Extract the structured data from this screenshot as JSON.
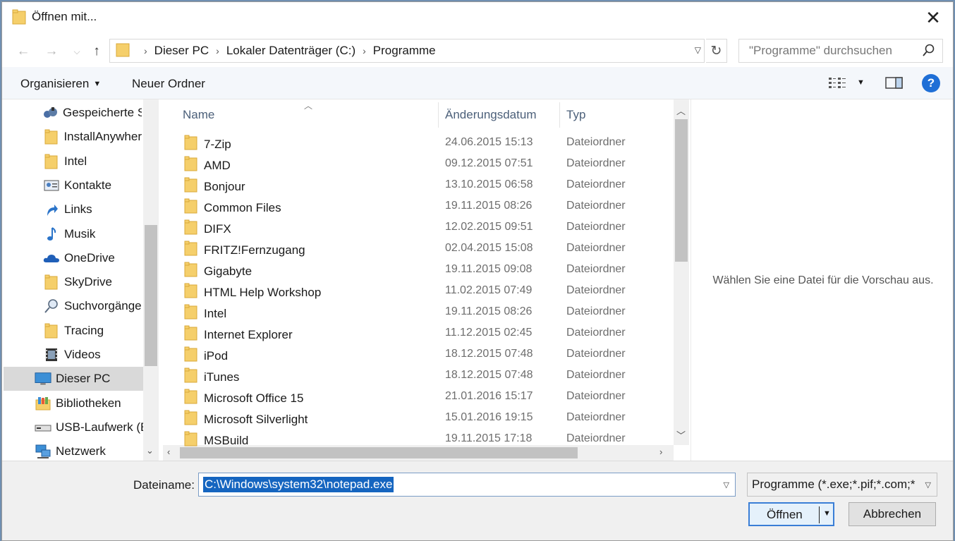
{
  "window": {
    "title": "Öffnen mit..."
  },
  "address": {
    "crumbs": [
      "Dieser PC",
      "Lokaler Datenträger (C:)",
      "Programme"
    ]
  },
  "search": {
    "placeholder": "\"Programme\" durchsuchen"
  },
  "toolbar": {
    "organize_label": "Organisieren",
    "new_folder_label": "Neuer Ordner",
    "help_label": "?"
  },
  "sidebar": {
    "items": [
      {
        "label": "Gespeicherte S",
        "icon": "saved-games-icon"
      },
      {
        "label": "InstallAnywher",
        "icon": "folder-icon"
      },
      {
        "label": "Intel",
        "icon": "folder-icon"
      },
      {
        "label": "Kontakte",
        "icon": "contacts-icon"
      },
      {
        "label": "Links",
        "icon": "links-icon"
      },
      {
        "label": "Musik",
        "icon": "music-icon"
      },
      {
        "label": "OneDrive",
        "icon": "onedrive-icon"
      },
      {
        "label": "SkyDrive",
        "icon": "folder-icon"
      },
      {
        "label": "Suchvorgänge",
        "icon": "search-icon"
      },
      {
        "label": "Tracing",
        "icon": "folder-icon"
      },
      {
        "label": "Videos",
        "icon": "videos-icon"
      },
      {
        "label": "Dieser PC",
        "icon": "computer-icon",
        "selected": true
      },
      {
        "label": "Bibliotheken",
        "icon": "libraries-icon"
      },
      {
        "label": "USB-Laufwerk (E",
        "icon": "usb-drive-icon"
      },
      {
        "label": "Netzwerk",
        "icon": "network-icon"
      }
    ]
  },
  "filelist": {
    "columns": [
      "Name",
      "Änderungsdatum",
      "Typ"
    ],
    "rows": [
      {
        "name": "7-Zip",
        "date": "24.06.2015 15:13",
        "type": "Dateiordner"
      },
      {
        "name": "AMD",
        "date": "09.12.2015 07:51",
        "type": "Dateiordner"
      },
      {
        "name": "Bonjour",
        "date": "13.10.2015 06:58",
        "type": "Dateiordner"
      },
      {
        "name": "Common Files",
        "date": "19.11.2015 08:26",
        "type": "Dateiordner"
      },
      {
        "name": "DIFX",
        "date": "12.02.2015 09:51",
        "type": "Dateiordner"
      },
      {
        "name": "FRITZ!Fernzugang",
        "date": "02.04.2015 15:08",
        "type": "Dateiordner"
      },
      {
        "name": "Gigabyte",
        "date": "19.11.2015 09:08",
        "type": "Dateiordner"
      },
      {
        "name": "HTML Help Workshop",
        "date": "11.02.2015 07:49",
        "type": "Dateiordner"
      },
      {
        "name": "Intel",
        "date": "19.11.2015 08:26",
        "type": "Dateiordner"
      },
      {
        "name": "Internet Explorer",
        "date": "11.12.2015 02:45",
        "type": "Dateiordner"
      },
      {
        "name": "iPod",
        "date": "18.12.2015 07:48",
        "type": "Dateiordner"
      },
      {
        "name": "iTunes",
        "date": "18.12.2015 07:48",
        "type": "Dateiordner"
      },
      {
        "name": "Microsoft Office 15",
        "date": "21.01.2016 15:17",
        "type": "Dateiordner"
      },
      {
        "name": "Microsoft Silverlight",
        "date": "15.01.2016 19:15",
        "type": "Dateiordner"
      },
      {
        "name": "MSBuild",
        "date": "19.11.2015 17:18",
        "type": "Dateiordner"
      }
    ]
  },
  "preview": {
    "message": "Wählen Sie eine Datei für die Vorschau aus."
  },
  "footer": {
    "filename_label": "Dateiname:",
    "filename_value": "C:\\Windows\\system32\\notepad.exe",
    "filter_value": "Programme (*.exe;*.pif;*.com;*",
    "open_label": "Öffnen",
    "cancel_label": "Abbrechen"
  },
  "colors": {
    "accent": "#1565c0",
    "folder": "#f5cf6b",
    "selection": "#d9d9d9"
  }
}
